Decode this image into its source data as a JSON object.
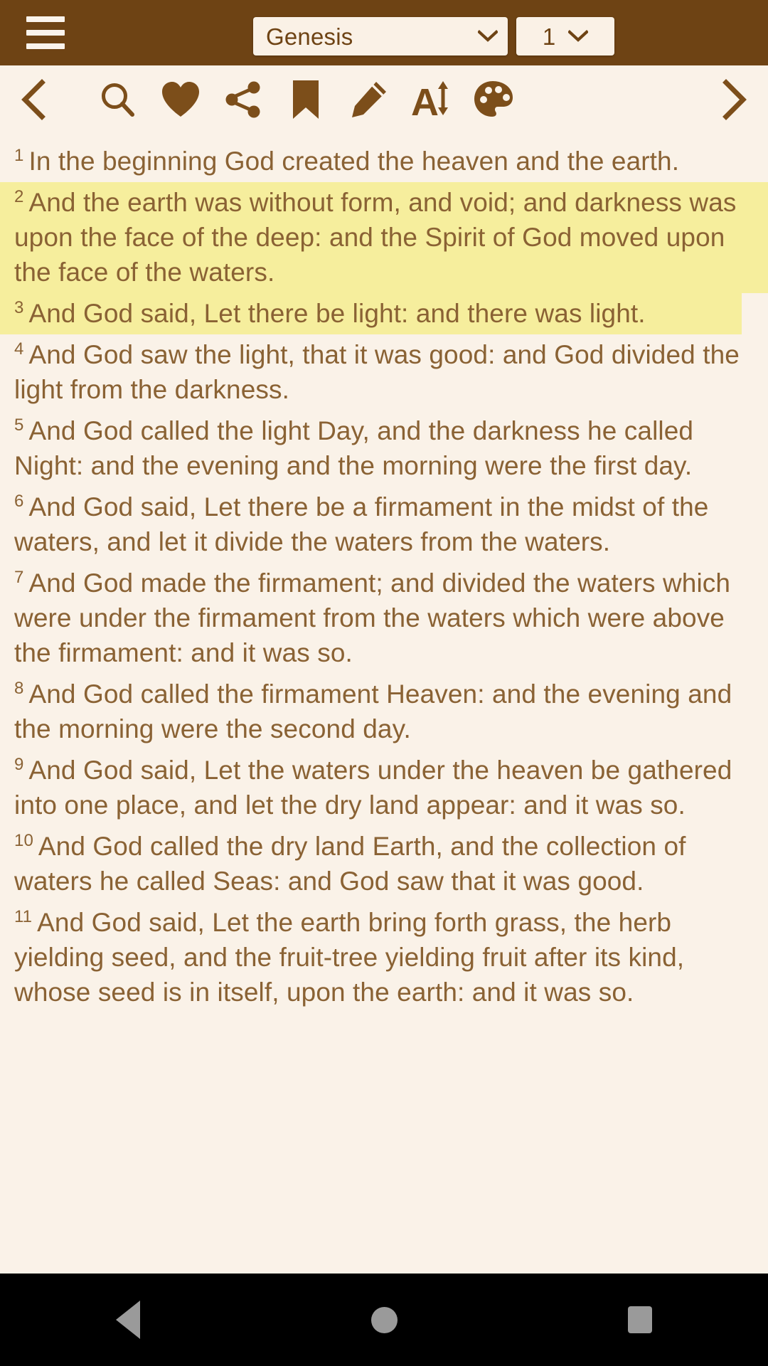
{
  "header": {
    "menu_icon": "hamburger-menu-icon",
    "book": {
      "value": "Genesis",
      "chevron_icon": "chevron-down-icon"
    },
    "chapter": {
      "value": "1",
      "chevron_icon": "chevron-down-icon"
    },
    "background_color": "#6E4314",
    "field_background_color": "#FAF1E6",
    "text_color": "#6E4314"
  },
  "toolbar": {
    "prev_label": "chevron-left-icon",
    "next_label": "chevron-right-icon",
    "items": [
      {
        "name": "search-icon",
        "label": "Search"
      },
      {
        "name": "heart-icon",
        "label": "Favorite"
      },
      {
        "name": "share-icon",
        "label": "Share"
      },
      {
        "name": "bookmark-icon",
        "label": "Bookmark"
      },
      {
        "name": "pencil-icon",
        "label": "Note"
      },
      {
        "name": "font-size-icon",
        "label": "Font Size"
      },
      {
        "name": "palette-icon",
        "label": "Theme"
      }
    ],
    "icon_color": "#7C4E1A",
    "background_color": "#FAF2E8"
  },
  "reader": {
    "background_color": "#FAF2E8",
    "text_color": "#8A6234",
    "highlight_color": "#F6EE9D",
    "verses": [
      {
        "num": "1",
        "text": "In the beginning God created the heaven and the earth.",
        "highlight": "none"
      },
      {
        "num": "2",
        "text": "And the earth was without form, and void; and darkness was upon the face of the deep: and the Spirit of God moved upon the face of the waters.",
        "highlight": "full"
      },
      {
        "num": "3",
        "text": "And God said, Let there be light: and there was light.",
        "highlight": "partial"
      },
      {
        "num": "4",
        "text": "And God saw the light, that it was good: and God divided the light from the darkness.",
        "highlight": "none"
      },
      {
        "num": "5",
        "text": "And God called the light Day, and the darkness he called Night: and the evening and the morning were the first day.",
        "highlight": "none"
      },
      {
        "num": "6",
        "text": "And God said, Let there be a firmament in the midst of the waters, and let it divide the waters from the waters.",
        "highlight": "none"
      },
      {
        "num": "7",
        "text": "And God made the firmament; and divided the waters which were under the firmament from the waters which were above the firmament: and it was so.",
        "highlight": "none"
      },
      {
        "num": "8",
        "text": "And God called the firmament Heaven: and the evening and the morning were the second day.",
        "highlight": "none"
      },
      {
        "num": "9",
        "text": "And God said, Let the waters under the heaven be gathered into one place, and let the dry land appear: and it was so.",
        "highlight": "none"
      },
      {
        "num": "10",
        "text": "And God called the dry land Earth, and the collection of waters he called Seas: and God saw that it was good.",
        "highlight": "none"
      },
      {
        "num": "11",
        "text": "And God said, Let the earth bring forth grass, the herb yielding seed, and the fruit-tree yielding fruit after its kind, whose seed is in itself, upon the earth: and it was so.",
        "highlight": "none"
      }
    ]
  },
  "system_nav": {
    "background_color": "#000000",
    "icon_color": "#9A9A9A",
    "back": "back-triangle-icon",
    "home": "home-circle-icon",
    "recents": "recents-square-icon"
  }
}
